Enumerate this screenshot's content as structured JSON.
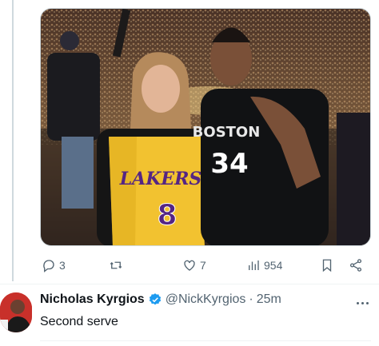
{
  "previous_tweet": {
    "media": {
      "jersey_left": {
        "team": "LAKERS",
        "number": "8"
      },
      "jersey_right": {
        "team": "BOSTON",
        "number": "34"
      }
    },
    "actions": {
      "replies": "3",
      "retweets": "",
      "likes": "7",
      "views": "954"
    }
  },
  "tweet": {
    "display_name": "Nicholas Kyrgios",
    "handle": "@NickKyrgios",
    "separator": "·",
    "time": "25m",
    "text": "Second serve"
  },
  "colors": {
    "verified": "#1d9bf0",
    "muted": "#536471",
    "lakers_gold": "#f2c230",
    "lakers_purple": "#552583"
  },
  "icons": [
    "reply-icon",
    "retweet-icon",
    "like-icon",
    "views-icon",
    "bookmark-icon",
    "share-icon",
    "verified-icon",
    "more-icon"
  ]
}
